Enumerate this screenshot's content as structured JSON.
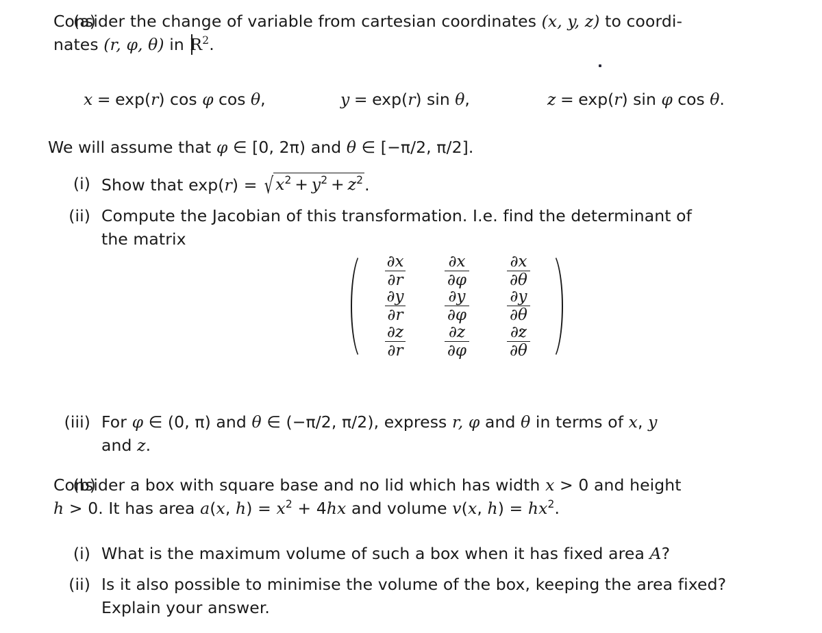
{
  "document": {
    "type": "mathematics-problem-sheet",
    "background_color": "#ffffff",
    "text_color": "#1a1a1a"
  },
  "part_a": {
    "marker": "(a)",
    "intro_line1": "Consider the change of variable from cartesian coordinates ",
    "intro_coords1": "(x, y, z)",
    "intro_line1_end": " to coordi-",
    "intro_line2_pre": "nates ",
    "intro_coords2": "(r, φ, θ)",
    "intro_line2_mid": " in ",
    "intro_space": "R",
    "intro_space_exp": "2",
    "intro_line2_end": ".",
    "equations": [
      {
        "lhs": "x",
        "eq": "=",
        "rhs": "exp(r) cos φ cos θ,",
        "name": "equation-x"
      },
      {
        "lhs": "y",
        "eq": "=",
        "rhs": "exp(r) sin θ,",
        "name": "equation-y"
      },
      {
        "lhs": "z",
        "eq": "=",
        "rhs": "exp(r) sin φ cos θ.",
        "name": "equation-z"
      }
    ],
    "assumption": {
      "pre": "We will assume that ",
      "phi": "φ",
      "in1": " ∈ ",
      "range1": "[0, 2π)",
      "and": " and ",
      "theta": "θ",
      "in2": " ∈ ",
      "range2": "[−π/2, π/2]",
      "end": "."
    },
    "items": [
      {
        "marker": "(i)",
        "text_pre": "Show that exp(",
        "var": "r",
        "text_mid": ") = ",
        "radicand": "x² + y² + z²",
        "text_end": ".",
        "name": "item-a-i"
      },
      {
        "marker": "(ii)",
        "line1": "Compute the Jacobian of this transformation. I.e. find the determinant of",
        "line2": "the matrix",
        "name": "item-a-ii"
      },
      {
        "marker": "(iii)",
        "line1_pre": "For ",
        "phi": "φ",
        "in1": " ∈ ",
        "range1": "(0, π)",
        "and": " and ",
        "theta": "θ",
        "in2": " ∈ ",
        "range2": "(−π/2, π/2)",
        "line1_mid": ", express ",
        "vars": "r, φ",
        "line1_and": " and ",
        "theta2": "θ",
        "line1_end": " in terms of x, y",
        "line2": "and z.",
        "name": "item-a-iii"
      }
    ],
    "matrix": {
      "name": "jacobian-matrix",
      "rows": [
        [
          {
            "numer": "∂x",
            "denom": "∂r"
          },
          {
            "numer": "∂x",
            "denom": "∂φ"
          },
          {
            "numer": "∂x",
            "denom": "∂θ"
          }
        ],
        [
          {
            "numer": "∂y",
            "denom": "∂r"
          },
          {
            "numer": "∂y",
            "denom": "∂φ"
          },
          {
            "numer": "∂y",
            "denom": "∂θ"
          }
        ],
        [
          {
            "numer": "∂z",
            "denom": "∂r"
          },
          {
            "numer": "∂z",
            "denom": "∂φ"
          },
          {
            "numer": "∂z",
            "denom": "∂θ"
          }
        ]
      ],
      "left_bracket": "(",
      "right_bracket": ")",
      "trailing_punctuation": "."
    }
  },
  "part_b": {
    "marker": "(b)",
    "line1": "Consider a box with square base and no lid which has width x > 0 and height",
    "line2_pre": "h > 0. It has area ",
    "line2_area": "a(x, h) = x² + 4hx",
    "line2_mid": " and volume ",
    "line2_volume": "v(x, h) = hx²",
    "line2_end": ".",
    "items": [
      {
        "marker": "(i)",
        "line1": "What is the maximum volume of such a box when it has fixed area A?",
        "name": "item-b-i"
      },
      {
        "marker": "(ii)",
        "line1": "Is it also possible to minimise the volume of the box, keeping the area fixed?",
        "line2": "Explain your answer.",
        "name": "item-b-ii"
      }
    ]
  }
}
